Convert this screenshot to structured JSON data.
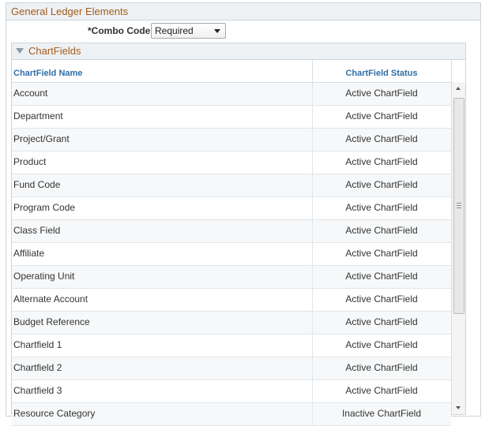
{
  "section": {
    "title": "General Ledger Elements"
  },
  "combo": {
    "label": "*Combo Code",
    "value": "Required"
  },
  "group": {
    "title": "ChartFields"
  },
  "grid": {
    "columns": [
      "ChartField Name",
      "ChartField Status"
    ],
    "rows": [
      {
        "name": "Account",
        "status": "Active ChartField"
      },
      {
        "name": "Department",
        "status": "Active ChartField"
      },
      {
        "name": "Project/Grant",
        "status": "Active ChartField"
      },
      {
        "name": "Product",
        "status": "Active ChartField"
      },
      {
        "name": "Fund Code",
        "status": "Active ChartField"
      },
      {
        "name": "Program Code",
        "status": "Active ChartField"
      },
      {
        "name": "Class Field",
        "status": "Active ChartField"
      },
      {
        "name": "Affiliate",
        "status": "Active ChartField"
      },
      {
        "name": "Operating Unit",
        "status": "Active ChartField"
      },
      {
        "name": "Alternate Account",
        "status": "Active ChartField"
      },
      {
        "name": "Budget Reference",
        "status": "Active ChartField"
      },
      {
        "name": "Chartfield 1",
        "status": "Active ChartField"
      },
      {
        "name": "Chartfield 2",
        "status": "Active ChartField"
      },
      {
        "name": "Chartfield 3",
        "status": "Active ChartField"
      },
      {
        "name": "Resource Category",
        "status": "Inactive ChartField"
      }
    ]
  },
  "colors": {
    "header_text": "#a25d1b",
    "column_header": "#2e6ea6",
    "panel_bg": "#eef1f4"
  },
  "icons": {
    "collapse": "triangle-down-icon",
    "dropdown": "chevron-down-icon"
  }
}
